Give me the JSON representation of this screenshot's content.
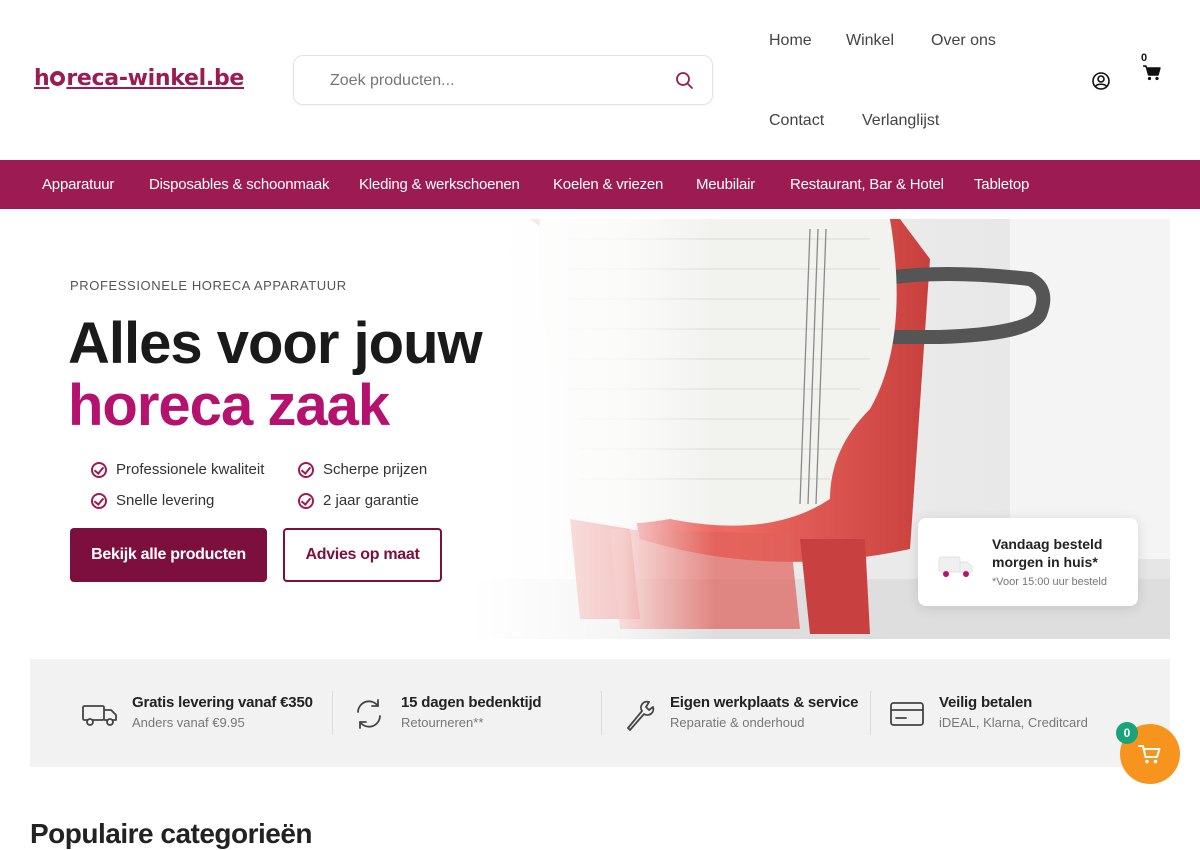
{
  "brand": {
    "logo_prefix": "h",
    "logo_suffix": "reca-winkel.be",
    "primary_color": "#9b1b52",
    "accent_color": "#b5116e",
    "button_color": "#7d0f3f",
    "cart_color": "#f7941d",
    "badge_color": "#1aa37a"
  },
  "search": {
    "placeholder": "Zoek producten..."
  },
  "topnav": {
    "home": "Home",
    "shop": "Winkel",
    "about": "Over ons",
    "contact": "Contact",
    "wishlist": "Verlanglijst"
  },
  "header_cart": {
    "count": "0"
  },
  "categories": [
    "Apparatuur",
    "Disposables & schoonmaak",
    "Kleding & werkschoenen",
    "Koelen & vriezen",
    "Meubilair",
    "Restaurant, Bar & Hotel",
    "Tabletop"
  ],
  "hero": {
    "eyebrow": "PROFESSIONELE HORECA APPARATUUR",
    "title_line1": "Alles voor jouw",
    "title_line2": "horeca zaak",
    "features": [
      "Professionele kwaliteit",
      "Scherpe prijzen",
      "Snelle levering",
      "2 jaar garantie"
    ],
    "cta_primary": "Bekijk alle producten",
    "cta_secondary": "Advies op maat",
    "delivery_title": "Vandaag besteld morgen in huis*",
    "delivery_note": "*Voor 15:00 uur besteld"
  },
  "usps": [
    {
      "title": "Gratis levering vanaf €350",
      "subtitle": "Anders vanaf €9.95",
      "icon": "truck-icon"
    },
    {
      "title": "15 dagen bedenktijd",
      "subtitle": "Retourneren**",
      "icon": "refresh-icon"
    },
    {
      "title": "Eigen werkplaats & service",
      "subtitle": "Reparatie & onderhoud",
      "icon": "wrench-icon"
    },
    {
      "title": "Veilig betalen",
      "subtitle": "iDEAL, Klarna, Creditcard",
      "icon": "credit-card-icon"
    }
  ],
  "floating_cart": {
    "count": "0"
  },
  "popular": {
    "title": "Populaire categorieën"
  }
}
